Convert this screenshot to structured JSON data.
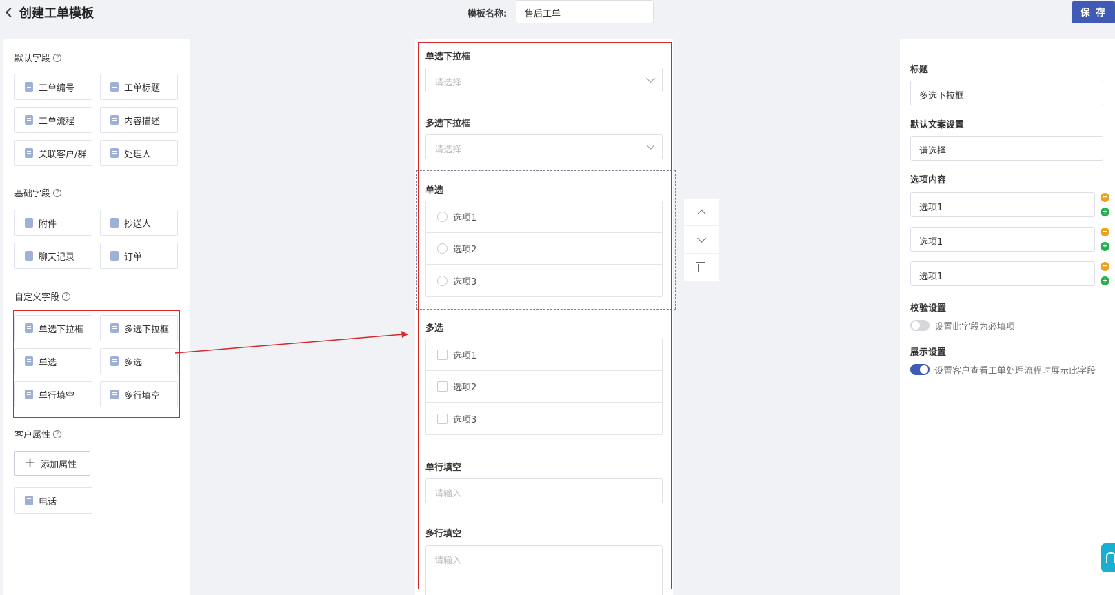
{
  "header": {
    "back_title": "创建工单模板",
    "template_name_label": "模板名称:",
    "template_name_value": "售后工单",
    "save_label": "保 存"
  },
  "left_panel": {
    "default_fields": {
      "title": "默认字段",
      "items": [
        "工单编号",
        "工单标题",
        "工单流程",
        "内容描述",
        "关联客户/群",
        "处理人"
      ]
    },
    "basic_fields": {
      "title": "基础字段",
      "items": [
        "附件",
        "抄送人",
        "聊天记录",
        "订单"
      ]
    },
    "custom_fields": {
      "title": "自定义字段",
      "items": [
        "单选下拉框",
        "多选下拉框",
        "单选",
        "多选",
        "单行填空",
        "多行填空"
      ]
    },
    "customer_attrs": {
      "title": "客户属性",
      "add_label": "添加属性",
      "items": [
        "电话"
      ]
    }
  },
  "canvas": {
    "single_dropdown": {
      "label": "单选下拉框",
      "placeholder": "请选择"
    },
    "multi_dropdown": {
      "label": "多选下拉框",
      "placeholder": "请选择"
    },
    "single_choice": {
      "label": "单选",
      "options": [
        "选项1",
        "选项2",
        "选项3"
      ]
    },
    "multi_choice": {
      "label": "多选",
      "options": [
        "选项1",
        "选项2",
        "选项3"
      ]
    },
    "single_line": {
      "label": "单行填空",
      "placeholder": "请输入"
    },
    "multi_line": {
      "label": "多行填空",
      "placeholder": "请输入"
    }
  },
  "right_panel": {
    "title_label": "标题",
    "title_value": "多选下拉框",
    "default_text_label": "默认文案设置",
    "default_text_value": "请选择",
    "options_label": "选项内容",
    "options": [
      "选项1",
      "选项1",
      "选项1"
    ],
    "validation_label": "校验设置",
    "required_text": "设置此字段为必填项",
    "required_on": false,
    "display_label": "展示设置",
    "display_text": "设置客户查看工单处理流程时展示此字段",
    "display_on": true
  },
  "colors": {
    "accent": "#3f5bb5",
    "highlight_red": "#d9262c",
    "remove_orange": "#f0a020",
    "add_green": "#22b04a"
  }
}
